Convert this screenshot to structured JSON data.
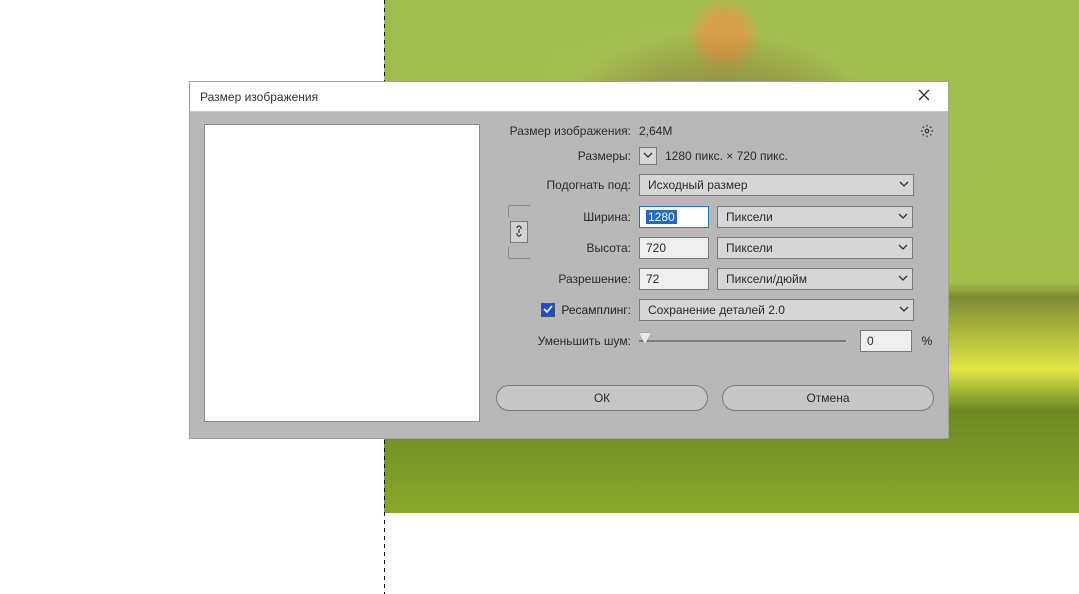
{
  "dialog": {
    "title": "Размер изображения",
    "image_size_label": "Размер изображения:",
    "image_size_value": "2,64M",
    "dimensions_label": "Размеры:",
    "dimensions_value": "1280 пикс. × 720 пикс.",
    "fit_to_label": "Подогнать под:",
    "fit_to_value": "Исходный размер",
    "width_label": "Ширина:",
    "width_value": "1280",
    "width_unit": "Пиксели",
    "height_label": "Высота:",
    "height_value": "720",
    "height_unit": "Пиксели",
    "resolution_label": "Разрешение:",
    "resolution_value": "72",
    "resolution_unit": "Пиксели/дюйм",
    "resample_label": "Ресамплинг:",
    "resample_value": "Сохранение деталей 2.0",
    "noise_label": "Уменьшить шум:",
    "noise_value": "0",
    "noise_unit": "%",
    "ok_label": "ОК",
    "cancel_label": "Отмена"
  }
}
